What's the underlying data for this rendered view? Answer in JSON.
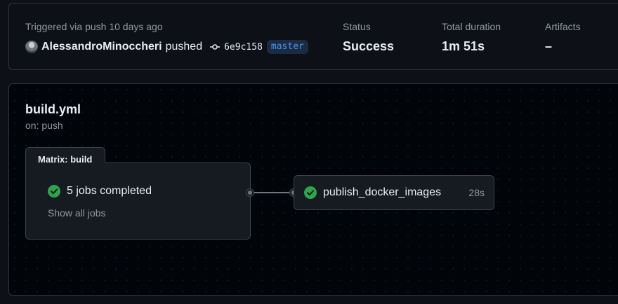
{
  "run_summary": {
    "trigger_text": "Triggered via push 10 days ago",
    "actor": "AlessandroMinoccheri",
    "action": "pushed",
    "commit_sha": "6e9c158",
    "branch": "master",
    "status_label": "Status",
    "status_value": "Success",
    "duration_label": "Total duration",
    "duration_value": "1m 51s",
    "artifacts_label": "Artifacts",
    "artifacts_value": "–"
  },
  "workflow": {
    "name": "build.yml",
    "trigger": "on: push",
    "matrix": {
      "title": "Matrix: build",
      "status": "5 jobs completed",
      "show_all": "Show all jobs"
    },
    "job": {
      "name": "publish_docker_images",
      "duration": "28s"
    }
  },
  "colors": {
    "success": "#2da44e",
    "background": "#0d1117",
    "link_blue": "#4493f8"
  },
  "icons": [
    "avatar",
    "git-commit-icon",
    "check-circle-icon"
  ]
}
